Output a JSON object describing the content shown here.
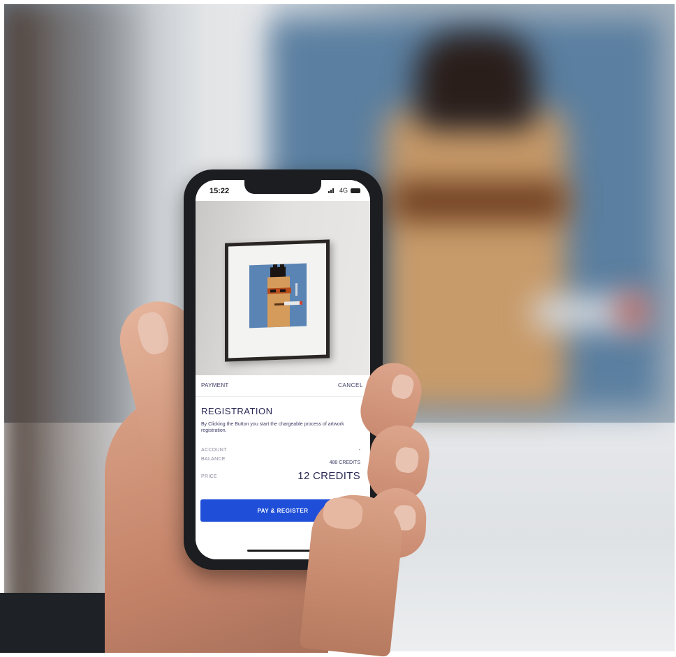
{
  "status_bar": {
    "time": "15:22",
    "network": "4G"
  },
  "payment": {
    "header_label": "PAYMENT",
    "cancel_label": "CANCEL",
    "title": "REGISTRATION",
    "description": "By Clicking the Button you start the chargeable process of artwork registration.",
    "account_label": "ACCOUNT",
    "account_value": "-",
    "balance_label": "BALANCE",
    "balance_value": "488 CREDITS",
    "price_label": "PRICE",
    "price_value": "12 CREDITS",
    "pay_button_label": "PAY & REGISTER"
  },
  "colors": {
    "accent_button": "#1f4fd8",
    "text_primary": "#2b2a55",
    "artwork_background": "#5a84b4"
  }
}
